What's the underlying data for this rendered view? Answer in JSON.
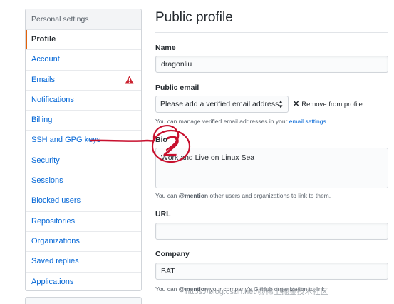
{
  "sidebar": {
    "header": "Personal settings",
    "items": [
      {
        "label": "Profile"
      },
      {
        "label": "Account"
      },
      {
        "label": "Emails"
      },
      {
        "label": "Notifications"
      },
      {
        "label": "Billing"
      },
      {
        "label": "SSH and GPG keys"
      },
      {
        "label": "Security"
      },
      {
        "label": "Sessions"
      },
      {
        "label": "Blocked users"
      },
      {
        "label": "Repositories"
      },
      {
        "label": "Organizations"
      },
      {
        "label": "Saved replies"
      },
      {
        "label": "Applications"
      }
    ],
    "selected_index": 0,
    "warning_item": "Emails",
    "warning_icon": "alert-icon"
  },
  "main": {
    "title": "Public profile",
    "name": {
      "label": "Name",
      "value": "dragonliu"
    },
    "public_email": {
      "label": "Public email",
      "selected": "Please add a verified email address",
      "remove_label": "Remove from profile",
      "note_prefix": "You can manage verified email addresses in your ",
      "note_link": "email settings",
      "note_suffix": "."
    },
    "bio": {
      "label": "Bio",
      "value": "Work and Live on Linux Sea",
      "note_prefix": "You can ",
      "note_mention": "@mention",
      "note_suffix": " other users and organizations to link to them."
    },
    "url": {
      "label": "URL",
      "value": ""
    },
    "company": {
      "label": "Company",
      "value": "BAT",
      "note_prefix": "You can ",
      "note_mention": "@mention",
      "note_suffix": " your company's GitHub organization to link"
    }
  },
  "annotation": {
    "number": "2",
    "color": "#c8102e"
  },
  "watermark": "https://blog.csdn.net/@稀土掘金技术社区",
  "colors": {
    "link": "#0366d6",
    "selected_accent": "#e36209",
    "warning": "#cb2431"
  }
}
